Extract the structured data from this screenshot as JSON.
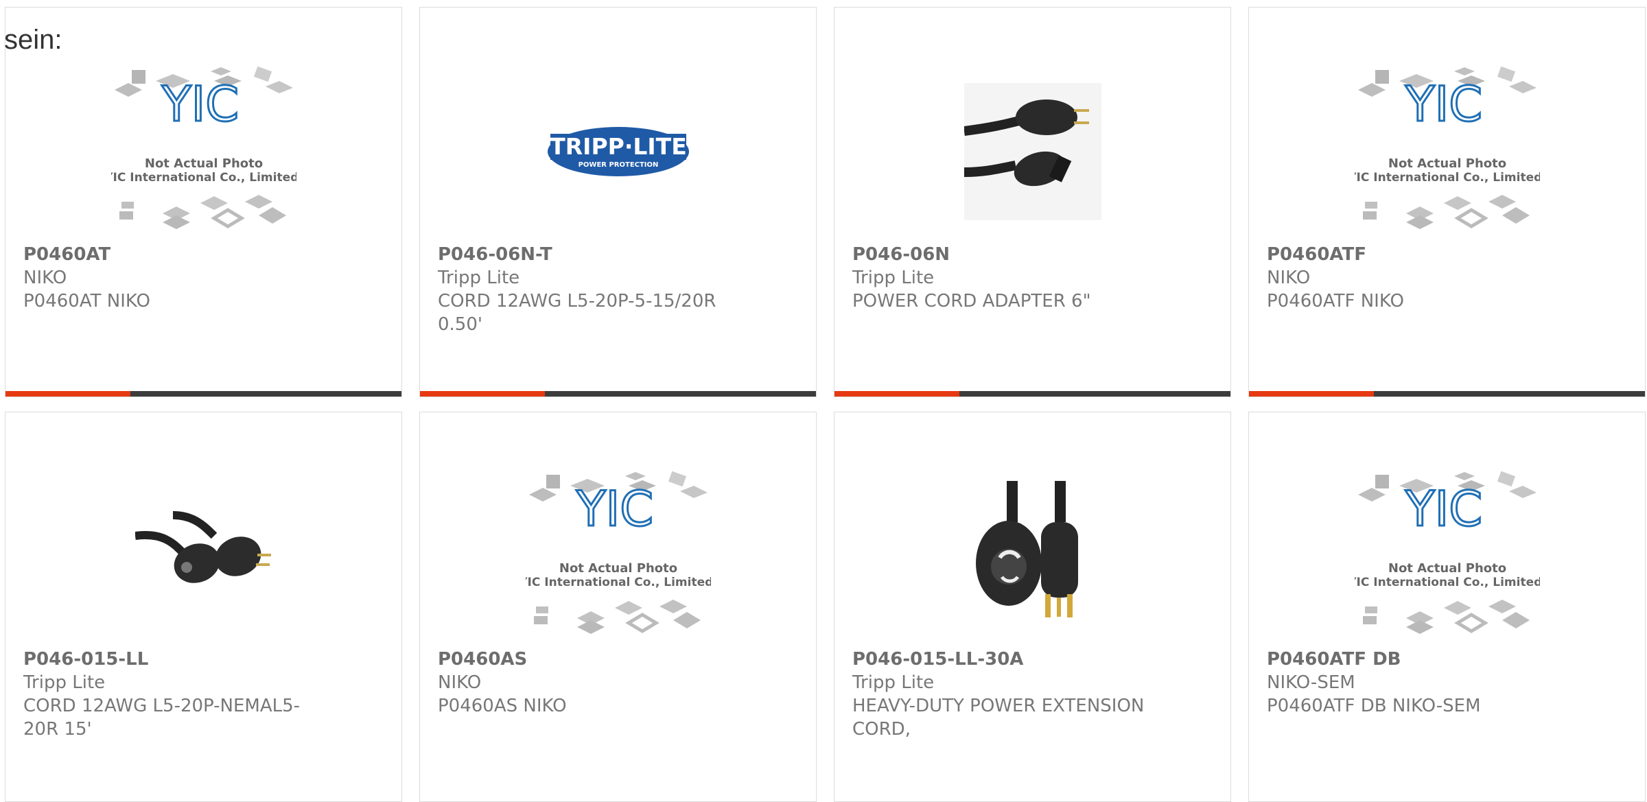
{
  "page": {
    "intro_text": "sein:"
  },
  "placeholder": {
    "line1": "Not Actual Photo",
    "line2": "YIC International Co., Limited."
  },
  "tripp_logo": {
    "main": "TRIPP·LITE",
    "sub": "POWER PROTECTION"
  },
  "colors": {
    "accent": "#e63912",
    "bar": "#3c3c3c",
    "logo_blue": "#1f5aa6"
  },
  "products": [
    {
      "part_number": "P0460AT",
      "manufacturer": "NIKO",
      "description": "P0460AT NIKO",
      "image": "yic-placeholder"
    },
    {
      "part_number": "P046-06N-T",
      "manufacturer": "Tripp Lite",
      "description": "CORD 12AWG L5-20P-5-15/20R 0.50'",
      "image": "tripp-lite-logo"
    },
    {
      "part_number": "P046-06N",
      "manufacturer": "Tripp Lite",
      "description": "POWER CORD ADAPTER 6\"",
      "image": "power-cord-adapter-photo"
    },
    {
      "part_number": "P0460ATF",
      "manufacturer": "NIKO",
      "description": "P0460ATF NIKO",
      "image": "yic-placeholder"
    },
    {
      "part_number": "P046-015-LL",
      "manufacturer": "Tripp Lite",
      "description": "CORD 12AWG L5-20P-NEMAL5-20R 15'",
      "image": "locking-cord-photo"
    },
    {
      "part_number": "P0460AS",
      "manufacturer": "NIKO",
      "description": "P0460AS NIKO",
      "image": "yic-placeholder"
    },
    {
      "part_number": "P046-015-LL-30A",
      "manufacturer": "Tripp Lite",
      "description": "HEAVY-DUTY POWER EXTENSION CORD,",
      "image": "heavy-duty-cord-photo"
    },
    {
      "part_number": "P0460ATF DB",
      "manufacturer": "NIKO-SEM",
      "description": "P0460ATF DB NIKO-SEM",
      "image": "yic-placeholder"
    }
  ]
}
